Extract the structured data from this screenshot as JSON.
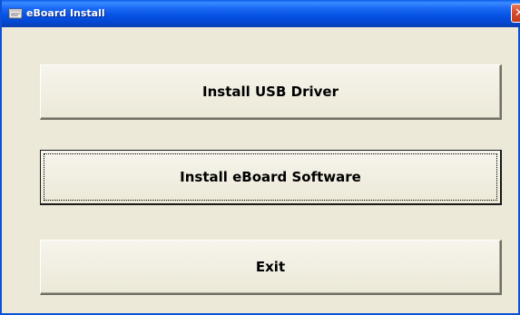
{
  "window": {
    "title": "eBoard Install",
    "title_icon": "installer-icon",
    "close_glyph": "✕"
  },
  "buttons": {
    "install_usb_driver": "Install USB Driver",
    "install_eboard_software": "Install eBoard Software",
    "exit": "Exit"
  },
  "colors": {
    "titlebar_blue": "#0552e3",
    "window_face": "#ece9d8",
    "close_red": "#d85030"
  }
}
